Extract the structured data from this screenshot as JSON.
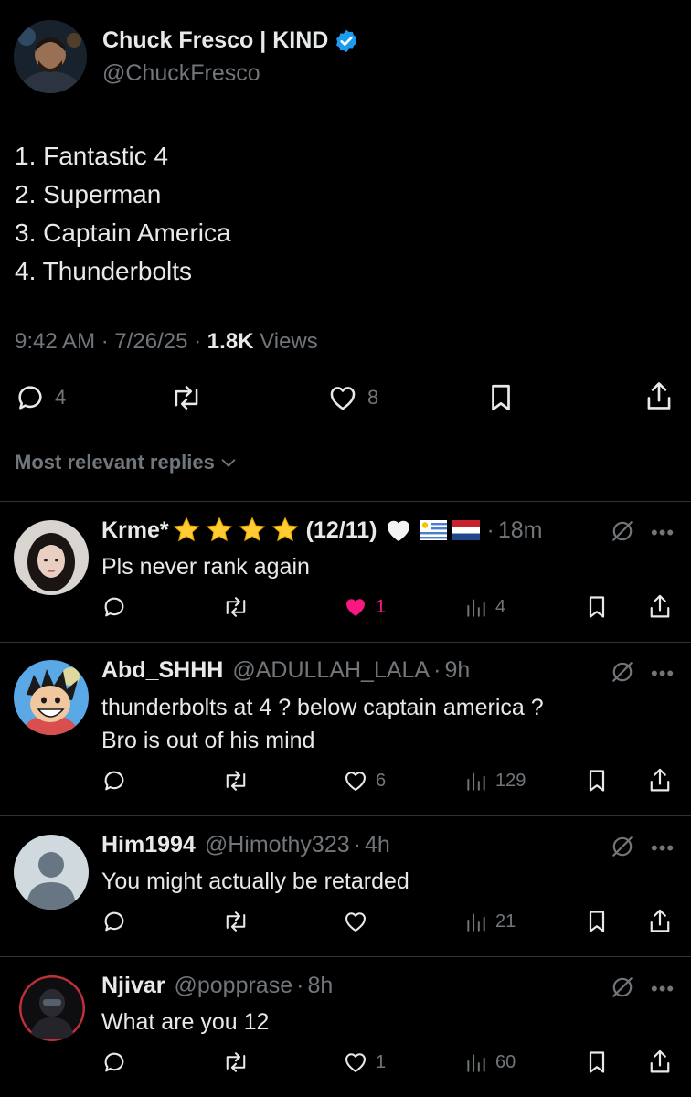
{
  "post": {
    "author_name": "Chuck Fresco | KIND",
    "author_handle": "@ChuckFresco",
    "lines": [
      "1. Fantastic 4",
      "2. Superman",
      "3. Captain America",
      "4. Thunderbolts"
    ],
    "time": "9:42 AM",
    "date": "7/26/25",
    "views_count": "1.8K",
    "views_label": "Views",
    "replies": "4",
    "likes": "8"
  },
  "replies_filter_label": "Most relevant replies",
  "replies": [
    {
      "name": "Krme*",
      "name_suffix": "(12/11)",
      "time": "18m",
      "text": [
        "Pls never rank again"
      ],
      "likes": "1",
      "views": "4"
    },
    {
      "name": "Abd_SHHH",
      "handle": "@ADULLAH_LALA",
      "time": "9h",
      "text": [
        "thunderbolts at 4 ? below captain america ?",
        "Bro is out of his mind"
      ],
      "likes": "6",
      "views": "129"
    },
    {
      "name": "Him1994",
      "handle": "@Himothy323",
      "time": "4h",
      "text": [
        "You might actually be retarded"
      ],
      "views": "21"
    },
    {
      "name": "Njivar",
      "handle": "@popprase",
      "time": "8h",
      "text": [
        "What are you 12"
      ],
      "likes": "1",
      "views": "60"
    }
  ],
  "colors": {
    "accent": "#1d9bf0",
    "liked": "#f91880",
    "muted": "#71767b",
    "text": "#e7e9ea",
    "divider": "#2f3336"
  }
}
